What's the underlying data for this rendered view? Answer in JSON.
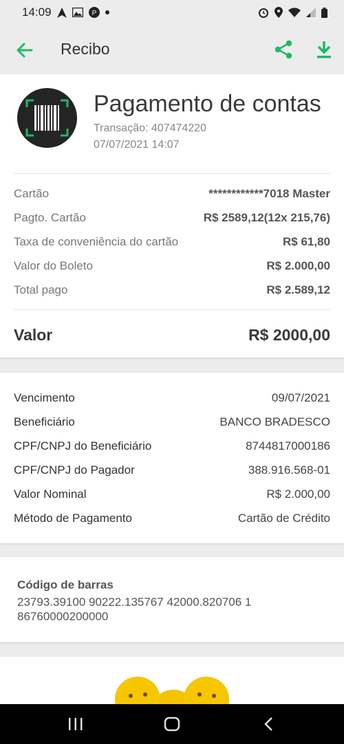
{
  "status": {
    "time": "14:09"
  },
  "appbar": {
    "title": "Recibo"
  },
  "header": {
    "title": "Pagamento de contas",
    "transaction": "Transação: 407474220",
    "datetime": "07/07/2021 14:07"
  },
  "payment_rows": [
    {
      "label": "Cartão",
      "value": "************7018 Master"
    },
    {
      "label": "Pagto. Cartão",
      "value": "R$ 2589,12(12x 215,76)"
    },
    {
      "label": "Taxa de conveniência do cartão",
      "value": "R$ 61,80"
    },
    {
      "label": "Valor do Boleto",
      "value": "R$ 2.000,00"
    },
    {
      "label": "Total pago",
      "value": "R$ 2.589,12"
    }
  ],
  "total": {
    "label": "Valor",
    "value": "R$ 2000,00"
  },
  "details": [
    {
      "label": "Vencimento",
      "value": "09/07/2021"
    },
    {
      "label": "Beneficiário",
      "value": "BANCO BRADESCO"
    },
    {
      "label": "CPF/CNPJ do Beneficiário",
      "value": "8744817000186"
    },
    {
      "label": "CPF/CNPJ do Pagador",
      "value": "388.916.568-01"
    },
    {
      "label": "Valor Nominal",
      "value": "R$ 2.000,00"
    },
    {
      "label": "Método de Pagamento",
      "value": "Cartão de Crédito"
    }
  ],
  "barcode": {
    "title": "Código de barras",
    "value": "23793.39100 90222.135767 42000.820706 1 86760000200000"
  },
  "colors": {
    "accent": "#1fb865",
    "navbar": "#000000"
  }
}
